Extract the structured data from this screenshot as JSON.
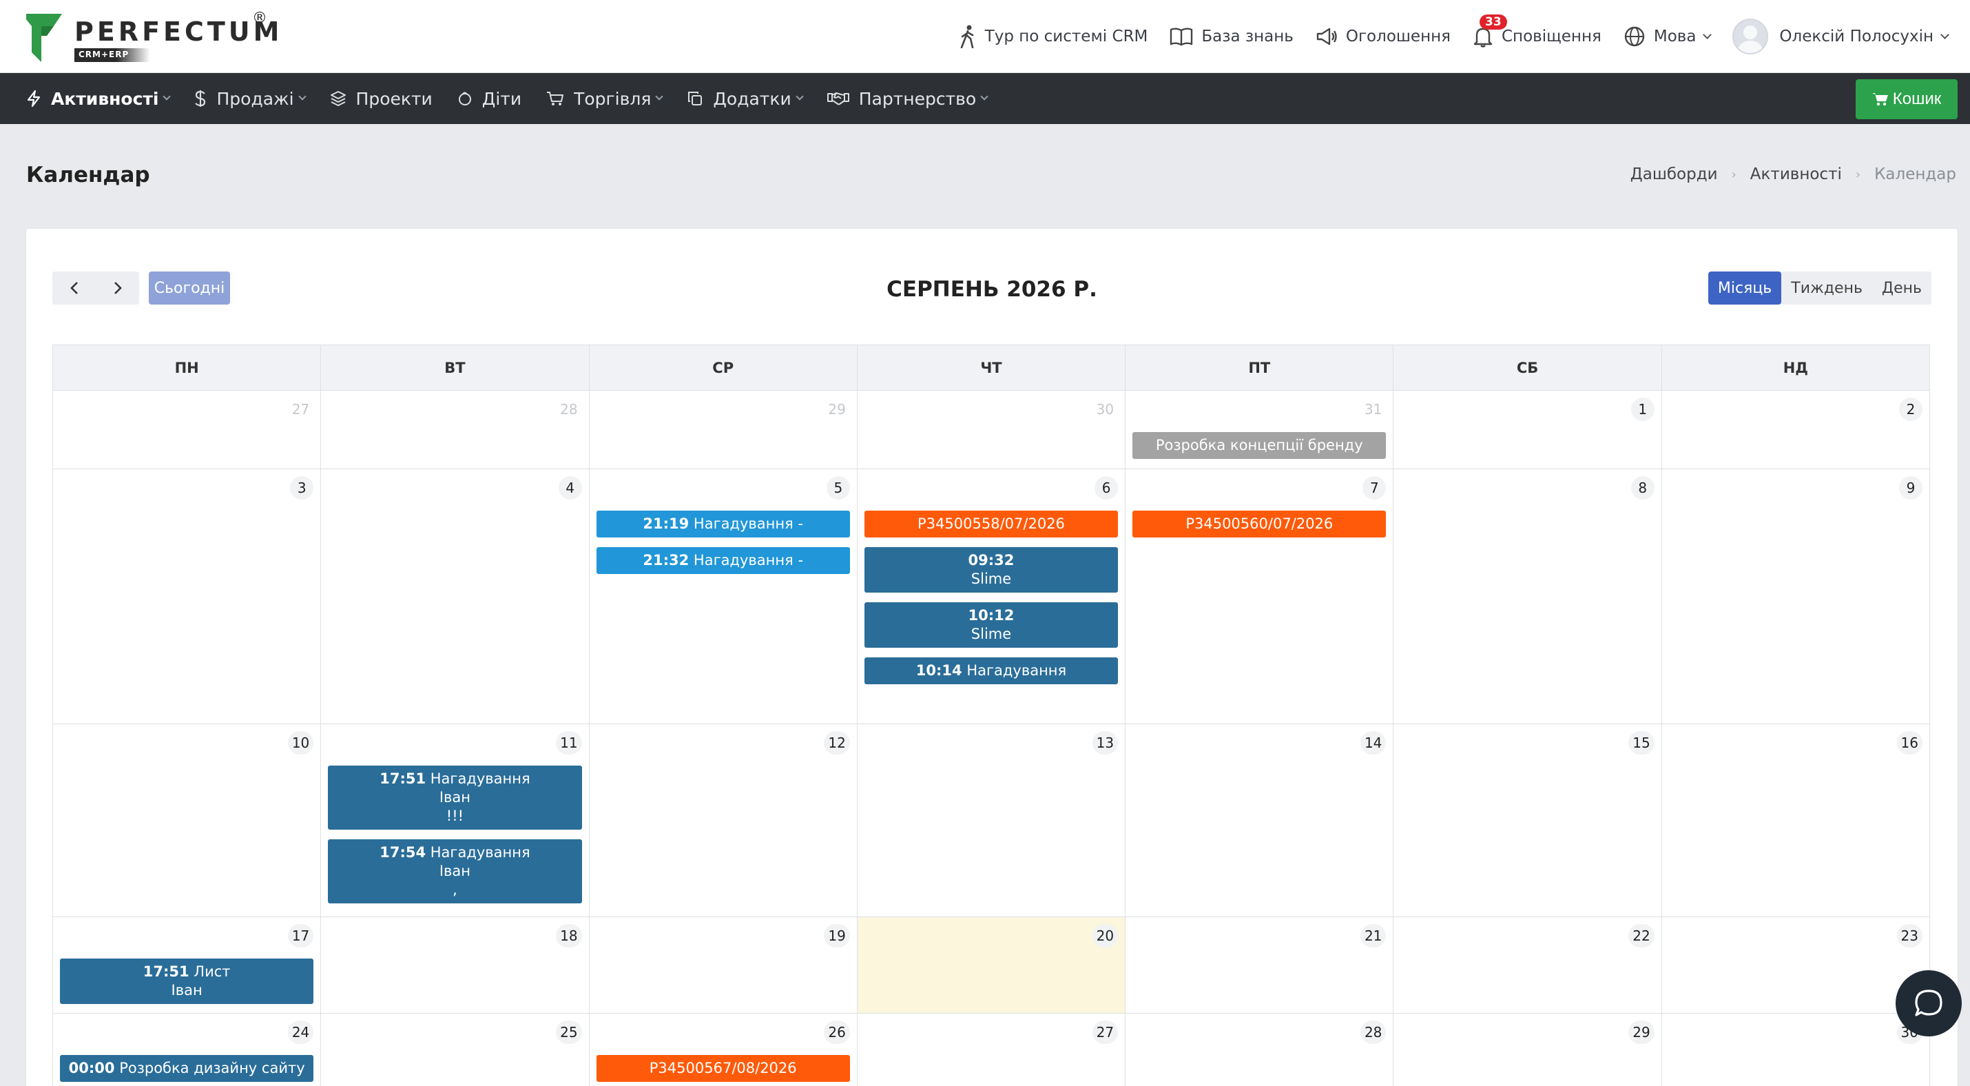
{
  "brand": {
    "name": "PERFECTUM",
    "sub": "CRM+ERP",
    "reg": "®"
  },
  "topnav": {
    "tour": "Тур по системі CRM",
    "kb": "База знань",
    "announce": "Оголошення",
    "notify": "Сповіщення",
    "notify_count": "33",
    "lang": "Мова",
    "user": "Олексій Полосухін"
  },
  "mainnav": {
    "items": [
      {
        "label": "Активності"
      },
      {
        "label": "Продажі"
      },
      {
        "label": "Проекти"
      },
      {
        "label": "Діти"
      },
      {
        "label": "Торгівля"
      },
      {
        "label": "Додатки"
      },
      {
        "label": "Партнерство"
      }
    ],
    "cart": "Кошик"
  },
  "page": {
    "title": "Календар"
  },
  "breadcrumb": [
    "Дашборди",
    "Активності",
    "Календар"
  ],
  "calendar": {
    "today_label": "Сьогодні",
    "title": "СЕРПЕНЬ 2026 Р.",
    "views": [
      "Місяць",
      "Тиждень",
      "День"
    ],
    "weekdays": [
      "ПН",
      "ВТ",
      "СР",
      "ЧТ",
      "ПТ",
      "СБ",
      "НД"
    ],
    "weeks": [
      {
        "days": [
          {
            "n": "27",
            "muted": true,
            "events": []
          },
          {
            "n": "28",
            "muted": true,
            "events": []
          },
          {
            "n": "29",
            "muted": true,
            "events": []
          },
          {
            "n": "30",
            "muted": true,
            "events": []
          },
          {
            "n": "31",
            "muted": true,
            "events": [
              {
                "color": "gray",
                "text": "Розробка концепції бренду"
              }
            ]
          },
          {
            "n": "1",
            "events": []
          },
          {
            "n": "2",
            "events": []
          }
        ]
      },
      {
        "days": [
          {
            "n": "3",
            "events": []
          },
          {
            "n": "4",
            "events": []
          },
          {
            "n": "5",
            "events": [
              {
                "color": "blue",
                "time": "21:19",
                "text": "Нагадування -"
              },
              {
                "color": "blue",
                "time": "21:32",
                "text": "Нагадування -"
              }
            ]
          },
          {
            "n": "6",
            "events": [
              {
                "color": "orange",
                "text": "P34500558/07/2026"
              },
              {
                "color": "teal",
                "time": "09:32",
                "lines": [
                  "Slime"
                ]
              },
              {
                "color": "teal",
                "time": "10:12",
                "lines": [
                  "Slime"
                ]
              },
              {
                "color": "teal",
                "time": "10:14",
                "text": "Нагадування"
              }
            ]
          },
          {
            "n": "7",
            "events": [
              {
                "color": "orange",
                "text": "P34500560/07/2026"
              }
            ]
          },
          {
            "n": "8",
            "events": []
          },
          {
            "n": "9",
            "events": []
          }
        ]
      },
      {
        "days": [
          {
            "n": "10",
            "events": []
          },
          {
            "n": "11",
            "events": [
              {
                "color": "teal",
                "time": "17:51",
                "text": "Нагадування",
                "lines": [
                  "Іван",
                  "!!!"
                ]
              },
              {
                "color": "teal",
                "time": "17:54",
                "text": "Нагадування",
                "lines": [
                  "Іван",
                  ","
                ]
              }
            ]
          },
          {
            "n": "12",
            "events": []
          },
          {
            "n": "13",
            "events": []
          },
          {
            "n": "14",
            "events": []
          },
          {
            "n": "15",
            "events": []
          },
          {
            "n": "16",
            "events": []
          }
        ]
      },
      {
        "days": [
          {
            "n": "17",
            "events": [
              {
                "color": "teal",
                "time": "17:51",
                "text": "Лист",
                "lines": [
                  "Іван"
                ]
              }
            ]
          },
          {
            "n": "18",
            "events": []
          },
          {
            "n": "19",
            "events": []
          },
          {
            "n": "20",
            "today": true,
            "events": []
          },
          {
            "n": "21",
            "events": []
          },
          {
            "n": "22",
            "events": []
          },
          {
            "n": "23",
            "events": []
          }
        ]
      },
      {
        "days": [
          {
            "n": "24",
            "events": [
              {
                "color": "teal",
                "time": "00:00",
                "text": "Розробка дизайну сайту"
              }
            ]
          },
          {
            "n": "25",
            "events": []
          },
          {
            "n": "26",
            "events": [
              {
                "color": "orange",
                "text": "P34500567/08/2026"
              }
            ]
          },
          {
            "n": "27",
            "events": []
          },
          {
            "n": "28",
            "events": []
          },
          {
            "n": "29",
            "events": []
          },
          {
            "n": "30",
            "events": []
          }
        ]
      }
    ]
  },
  "colors": {
    "nav_bg": "#2d3136",
    "cart": "#2ca24c",
    "blue": "#2196d8",
    "teal": "#2a6d99",
    "orange": "#ff5a0a",
    "gray": "#a3a3a3",
    "today_bg": "#fbf6dc",
    "view_active": "#3d64c4"
  }
}
